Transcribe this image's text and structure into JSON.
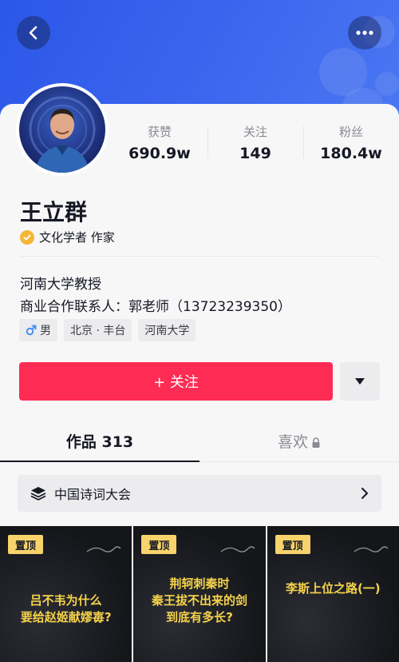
{
  "header": {
    "back_icon": "chevron-left-icon",
    "more_icon": "ellipsis-icon",
    "banner_color": "#3a63ee"
  },
  "profile": {
    "name": "王立群",
    "verification": "文化学者 作家",
    "bio_line1": "河南大学教授",
    "bio_line2": "商业合作联系人：郭老师（13723239350）",
    "tags": [
      {
        "icon": "male-icon",
        "label": "男"
      },
      {
        "label": "北京 · 丰台"
      },
      {
        "label": "河南大学"
      }
    ]
  },
  "stats": [
    {
      "label": "获赞",
      "value": "690.9w"
    },
    {
      "label": "关注",
      "value": "149"
    },
    {
      "label": "粉丝",
      "value": "180.4w"
    }
  ],
  "actions": {
    "follow_label": "+ 关注",
    "follow_color": "#fe2c55"
  },
  "tabs": [
    {
      "label": "作品 313",
      "active": true
    },
    {
      "label": "喜欢",
      "active": false,
      "locked": true
    }
  ],
  "collection": {
    "label": "中国诗词大会"
  },
  "videos": [
    {
      "pin_label": "置顶",
      "caption_line1": "吕不韦为什么",
      "caption_line2": "要给赵姬献嫪毐?"
    },
    {
      "pin_label": "置顶",
      "caption_line1": "荆轲刺秦时",
      "caption_line2": "秦王拔不出来的剑",
      "caption_line3": "到底有多长?"
    },
    {
      "pin_label": "置顶",
      "caption_line1": "李斯上位之路(一)"
    }
  ]
}
